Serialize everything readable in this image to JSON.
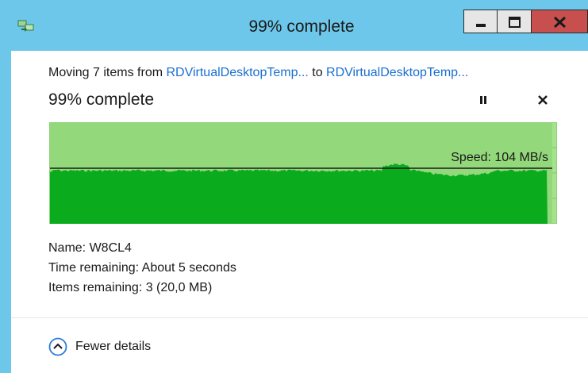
{
  "window": {
    "title": "99% complete",
    "icon": "file-move-icon",
    "controls": {
      "minimize": "minimize-icon",
      "maximize": "maximize-icon",
      "close": "close-icon"
    }
  },
  "operation": {
    "prefix": "Moving 7 items from ",
    "source": "RDVirtualDesktopTemp...",
    "middle": " to ",
    "destination": "RDVirtualDesktopTemp..."
  },
  "progress": {
    "percent_text": "99% complete",
    "fraction": 0.99
  },
  "speed": {
    "label": "Speed: 104 MB/s"
  },
  "details": {
    "name": "Name:  W8CL4",
    "time_remaining": "Time remaining:  About 5 seconds",
    "items_remaining": "Items remaining:  3 (20,0 MB)"
  },
  "footer": {
    "toggle_label": "Fewer details"
  },
  "colors": {
    "titlebar": "#6cc7ea",
    "graph_bg": "#a4e28c",
    "graph_fill": "#0bab1e",
    "close_button": "#c7504f",
    "link": "#1a6fd1"
  }
}
